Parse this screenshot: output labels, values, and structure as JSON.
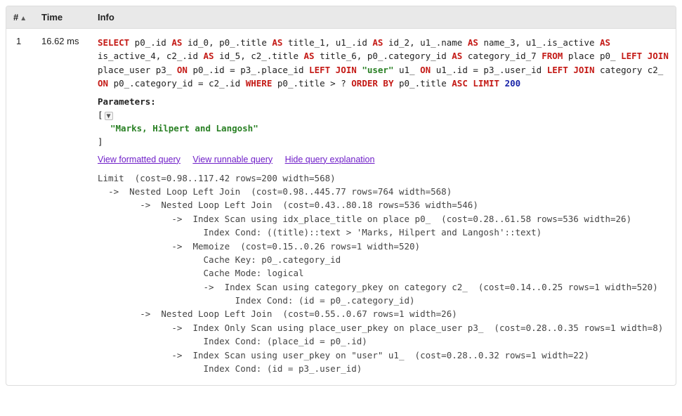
{
  "headers": {
    "num": "#",
    "time": "Time",
    "info": "Info"
  },
  "row": {
    "num": "1",
    "time": "16.62 ms",
    "sql_tokens": [
      {
        "t": "kw",
        "v": "SELECT"
      },
      {
        "t": "pl",
        "v": " p0_.id "
      },
      {
        "t": "kw",
        "v": "AS"
      },
      {
        "t": "pl",
        "v": " id_0, p0_.title "
      },
      {
        "t": "kw",
        "v": "AS"
      },
      {
        "t": "pl",
        "v": " title_1, u1_.id "
      },
      {
        "t": "kw",
        "v": "AS"
      },
      {
        "t": "pl",
        "v": " id_2, u1_.name "
      },
      {
        "t": "kw",
        "v": "AS"
      },
      {
        "t": "pl",
        "v": " name_3, u1_.is_active "
      },
      {
        "t": "kw",
        "v": "AS"
      },
      {
        "t": "pl",
        "v": " is_active_4, c2_.id "
      },
      {
        "t": "kw",
        "v": "AS"
      },
      {
        "t": "pl",
        "v": " id_5, c2_.title "
      },
      {
        "t": "kw",
        "v": "AS"
      },
      {
        "t": "pl",
        "v": " title_6, p0_.category_id "
      },
      {
        "t": "kw",
        "v": "AS"
      },
      {
        "t": "pl",
        "v": " category_id_7 "
      },
      {
        "t": "kw",
        "v": "FROM"
      },
      {
        "t": "pl",
        "v": " place p0_ "
      },
      {
        "t": "kw",
        "v": "LEFT JOIN"
      },
      {
        "t": "pl",
        "v": " place_user p3_ "
      },
      {
        "t": "kw",
        "v": "ON"
      },
      {
        "t": "pl",
        "v": " p0_.id = p3_.place_id "
      },
      {
        "t": "kw",
        "v": "LEFT JOIN"
      },
      {
        "t": "pl",
        "v": " "
      },
      {
        "t": "tbl",
        "v": "\"user\""
      },
      {
        "t": "pl",
        "v": " u1_ "
      },
      {
        "t": "kw",
        "v": "ON"
      },
      {
        "t": "pl",
        "v": " u1_.id = p3_.user_id "
      },
      {
        "t": "kw",
        "v": "LEFT JOIN"
      },
      {
        "t": "pl",
        "v": " category c2_ "
      },
      {
        "t": "kw",
        "v": "ON"
      },
      {
        "t": "pl",
        "v": " p0_.category_id = c2_.id "
      },
      {
        "t": "kw",
        "v": "WHERE"
      },
      {
        "t": "pl",
        "v": " p0_.title > ? "
      },
      {
        "t": "kw",
        "v": "ORDER BY"
      },
      {
        "t": "pl",
        "v": " p0_.title "
      },
      {
        "t": "kw",
        "v": "ASC"
      },
      {
        "t": "pl",
        "v": " "
      },
      {
        "t": "kw",
        "v": "LIMIT"
      },
      {
        "t": "pl",
        "v": " "
      },
      {
        "t": "num",
        "v": "200"
      }
    ],
    "parameters_label": "Parameters",
    "param_open": "[",
    "param_close": "]",
    "param_value": "\"Marks, Hilpert and Langosh\"",
    "links": {
      "formatted": "View formatted query",
      "runnable": "View runnable query",
      "explain": "Hide query explanation"
    },
    "explain": "Limit  (cost=0.98..117.42 rows=200 width=568)\n  ->  Nested Loop Left Join  (cost=0.98..445.77 rows=764 width=568)\n        ->  Nested Loop Left Join  (cost=0.43..80.18 rows=536 width=546)\n              ->  Index Scan using idx_place_title on place p0_  (cost=0.28..61.58 rows=536 width=26)\n                    Index Cond: ((title)::text > 'Marks, Hilpert and Langosh'::text)\n              ->  Memoize  (cost=0.15..0.26 rows=1 width=520)\n                    Cache Key: p0_.category_id\n                    Cache Mode: logical\n                    ->  Index Scan using category_pkey on category c2_  (cost=0.14..0.25 rows=1 width=520)\n                          Index Cond: (id = p0_.category_id)\n        ->  Nested Loop Left Join  (cost=0.55..0.67 rows=1 width=26)\n              ->  Index Only Scan using place_user_pkey on place_user p3_  (cost=0.28..0.35 rows=1 width=8)\n                    Index Cond: (place_id = p0_.id)\n              ->  Index Scan using user_pkey on \"user\" u1_  (cost=0.28..0.32 rows=1 width=22)\n                    Index Cond: (id = p3_.user_id)"
  }
}
